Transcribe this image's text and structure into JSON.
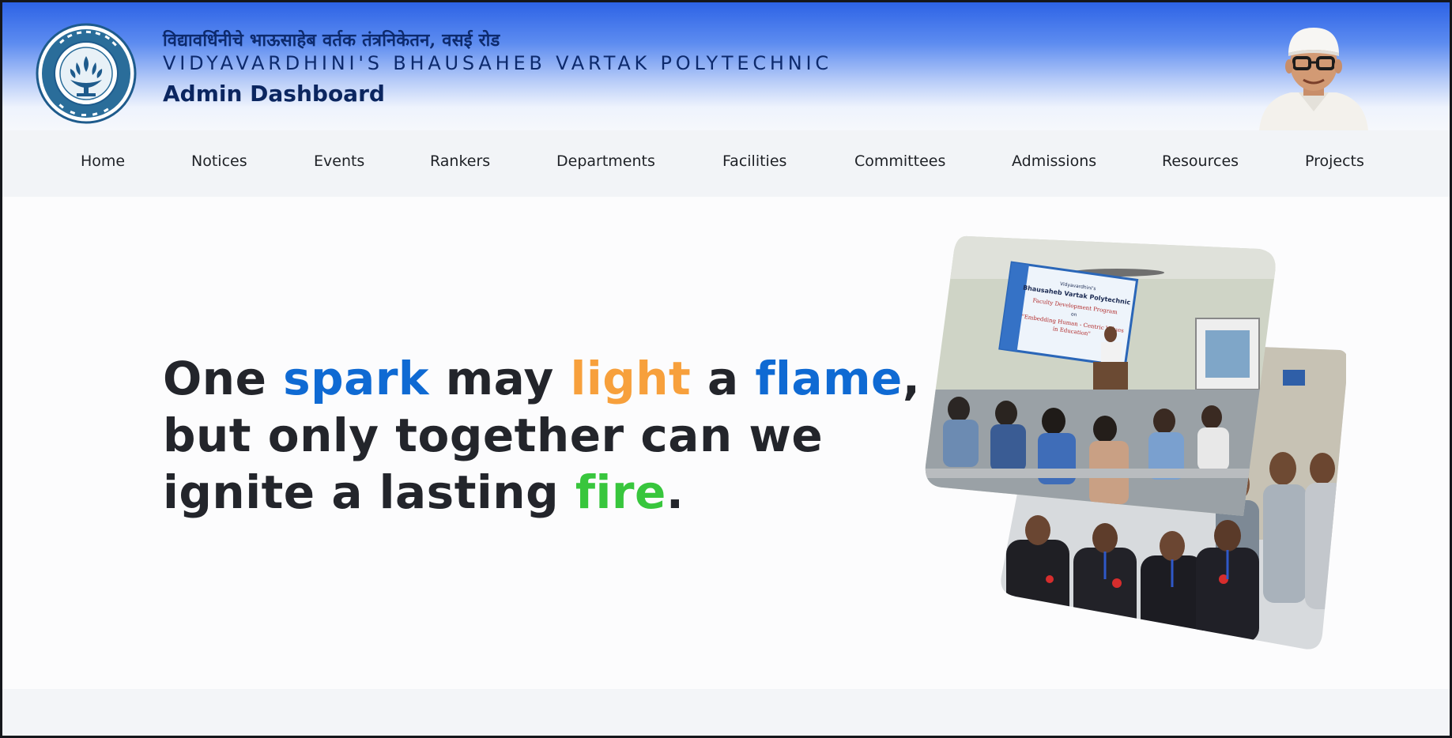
{
  "header": {
    "marathi_title": "विद्यावर्धिनीचे भाऊसाहेब वर्तक तंत्रनिकेतन, वसई रोड",
    "english_title": "VIDYAVARDHINI'S BHAUSAHEB VARTAK POLYTECHNIC",
    "dashboard_title": "Admin Dashboard",
    "logo_icon": "college-emblem-logo",
    "portrait_icon": "founder-portrait"
  },
  "nav": {
    "items": [
      "Home",
      "Notices",
      "Events",
      "Rankers",
      "Departments",
      "Facilities",
      "Committees",
      "Admissions",
      "Resources",
      "Projects"
    ]
  },
  "hero": {
    "line1": {
      "w1": "One ",
      "w2": "spark",
      "w3": " may ",
      "w4": "light",
      "w5": " a ",
      "w6": "flame",
      "w7": ","
    },
    "line2": "but only together can we",
    "line3": {
      "w1": "ignite a lasting ",
      "w2": "fire",
      "w3": "."
    },
    "photo_banner": {
      "line1": "Vidyavardhini's",
      "line2": "Bhausaheb Vartak Polytechnic",
      "line3": "Faculty Development Program",
      "line4": "on",
      "line5": "\"Embedding Human - Centric Values",
      "line6": "in Education\""
    }
  },
  "colors": {
    "accent_blue": "#0f6ad3",
    "accent_orange": "#f7a03c",
    "accent_green": "#38c63d",
    "heading_dark": "#0b2660"
  }
}
